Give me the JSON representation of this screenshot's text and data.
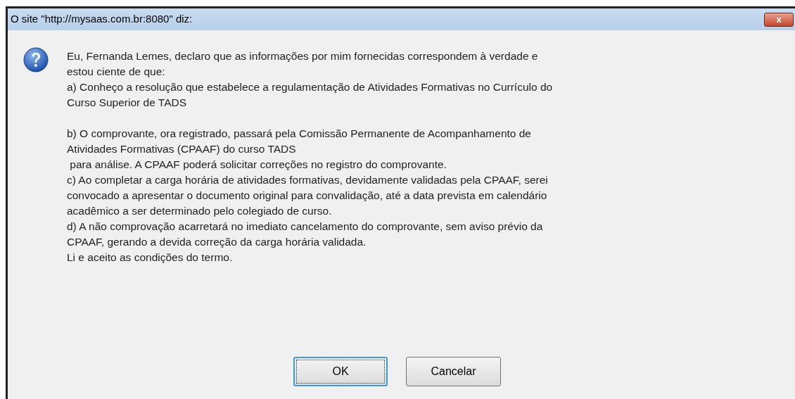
{
  "window": {
    "title": "O site \"http://mysaas.com.br:8080\" diz:",
    "close": "x"
  },
  "message": {
    "paragraphs": [
      [
        "Eu, Fernanda Lemes, declaro que as informações por mim fornecidas correspondem à verdade e",
        "estou ciente de que:",
        "a) Conheço a resolução que estabelece a regulamentação de Atividades Formativas no Currículo do",
        "Curso Superior de TADS"
      ],
      [
        "b) O comprovante, ora registrado, passará pela Comissão Permanente de Acompanhamento de",
        "Atividades Formativas (CPAAF) do curso TADS",
        " para análise. A CPAAF poderá solicitar correções no registro do comprovante.",
        "c) Ao completar a carga horária de atividades formativas, devidamente validadas pela CPAAF, serei",
        "convocado a apresentar o documento original para convalidação, até a data prevista em calendário",
        "acadêmico a ser determinado pelo colegiado de curso.",
        "d) A não comprovação acarretará no imediato cancelamento do comprovante, sem aviso prévio da",
        "CPAAF, gerando a devida correção da carga horária validada.",
        "Li e aceito as condições do termo."
      ]
    ]
  },
  "buttons": [
    {
      "label": "OK",
      "selected": true
    },
    {
      "label": "Cancelar",
      "selected": false
    }
  ]
}
